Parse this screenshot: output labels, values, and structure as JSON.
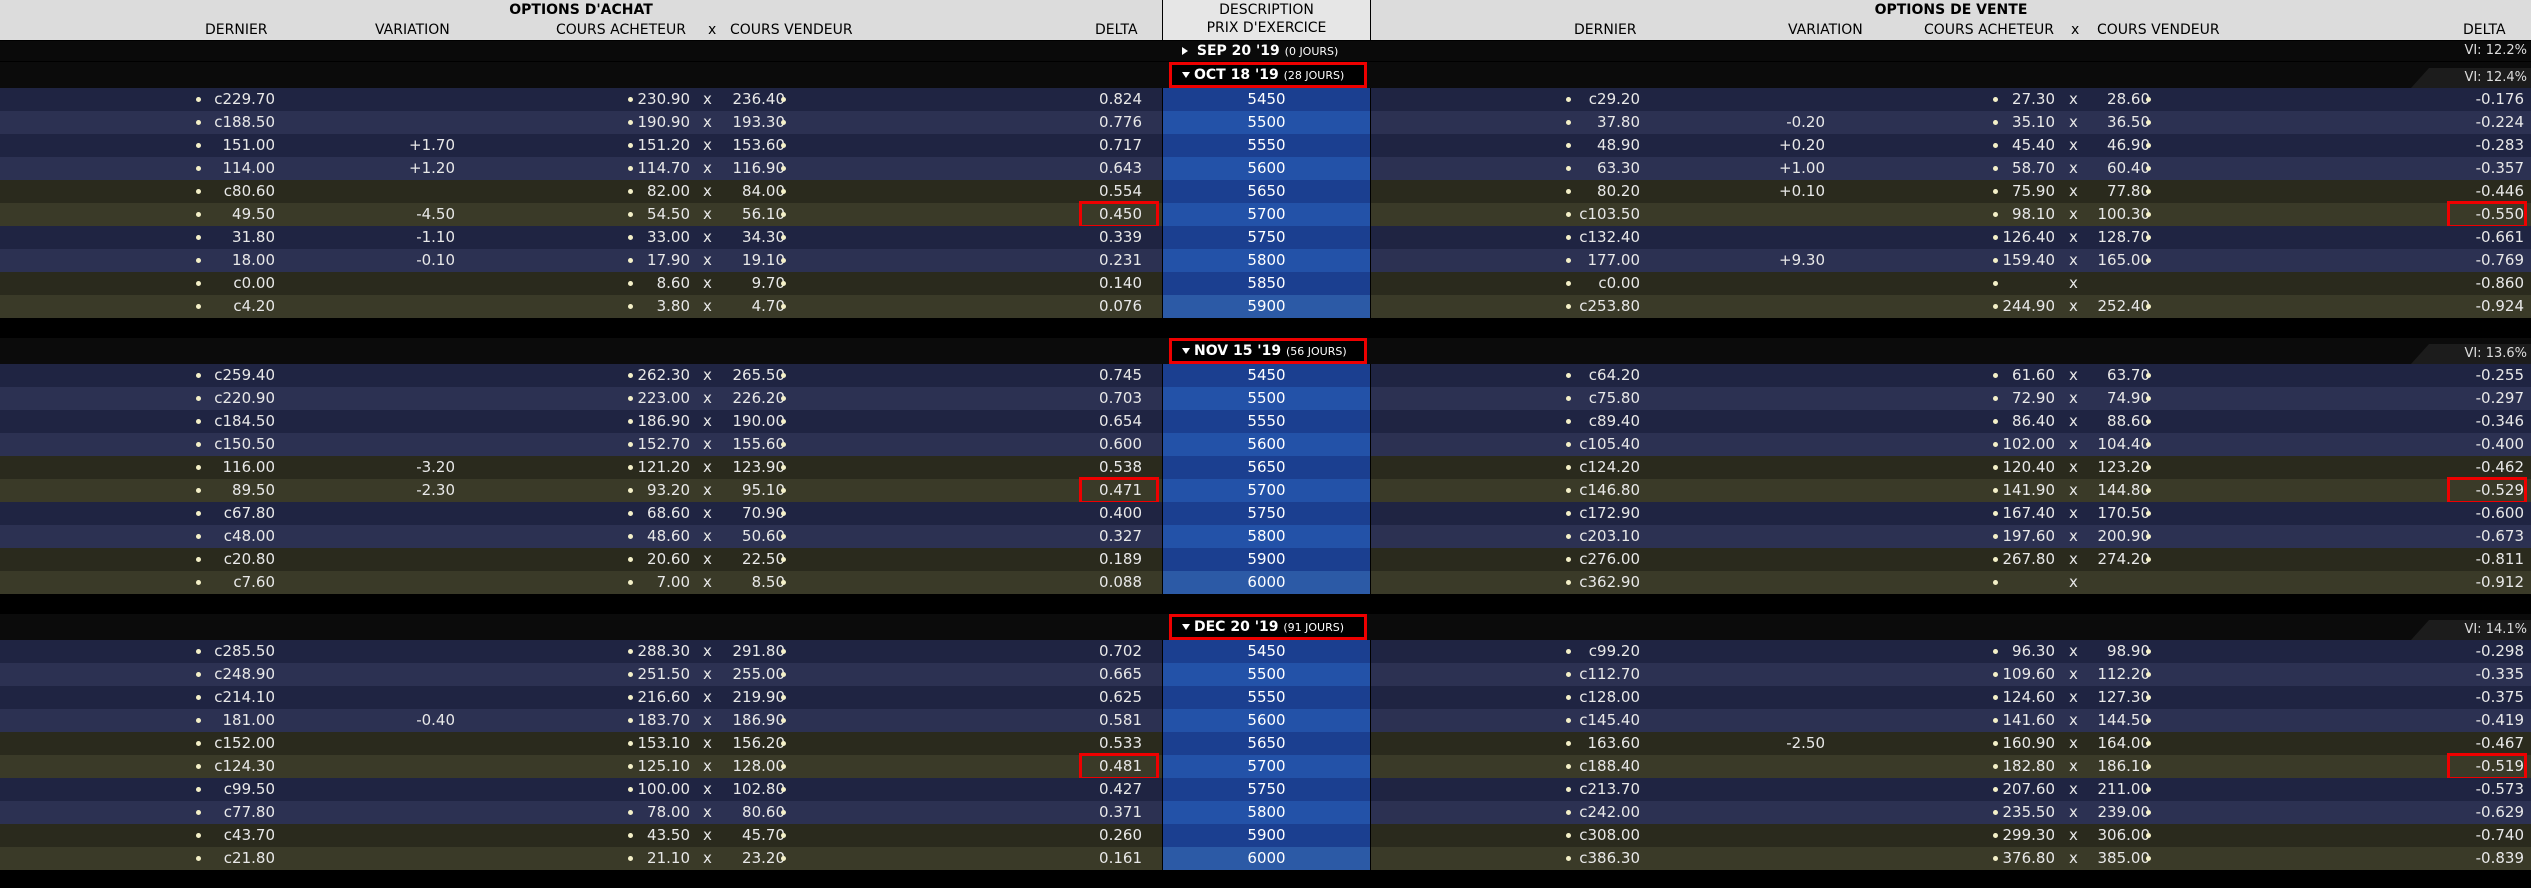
{
  "headers": {
    "calls_title": "OPTIONS D'ACHAT",
    "puts_title": "OPTIONS DE VENTE",
    "description": "DESCRIPTION",
    "strike": "PRIX D'EXERCICE",
    "last": "DERNIER",
    "change": "VARIATION",
    "bid": "COURS ACHETEUR",
    "x": "x",
    "ask": "COURS VENDEUR",
    "delta": "DELTA"
  },
  "sep_expiry": {
    "label": "SEP 20 '19",
    "days": "(0 JOURS)",
    "vi": "VI: 12.2%"
  },
  "expiries": [
    {
      "label": "OCT 18 '19",
      "days": "(28 JOURS)",
      "vi": "VI: 12.4%",
      "rows": [
        {
          "strike": "5450",
          "c_last": "c229.70",
          "c_chg": "",
          "c_bid": "230.90",
          "c_ask": "236.40",
          "c_delta": "0.824",
          "p_last": "c29.20",
          "p_chg": "",
          "p_bid": "27.30",
          "p_ask": "28.60",
          "p_delta": "-0.176"
        },
        {
          "strike": "5500",
          "c_last": "c188.50",
          "c_chg": "",
          "c_bid": "190.90",
          "c_ask": "193.30",
          "c_delta": "0.776",
          "p_last": "37.80",
          "p_chg": "-0.20",
          "p_bid": "35.10",
          "p_ask": "36.50",
          "p_delta": "-0.224"
        },
        {
          "strike": "5550",
          "c_last": "151.00",
          "c_chg": "+1.70",
          "c_bid": "151.20",
          "c_ask": "153.60",
          "c_delta": "0.717",
          "p_last": "48.90",
          "p_chg": "+0.20",
          "p_bid": "45.40",
          "p_ask": "46.90",
          "p_delta": "-0.283"
        },
        {
          "strike": "5600",
          "c_last": "114.00",
          "c_chg": "+1.20",
          "c_bid": "114.70",
          "c_ask": "116.90",
          "c_delta": "0.643",
          "p_last": "63.30",
          "p_chg": "+1.00",
          "p_bid": "58.70",
          "p_ask": "60.40",
          "p_delta": "-0.357"
        },
        {
          "strike": "5650",
          "c_last": "c80.60",
          "c_chg": "",
          "c_bid": "82.00",
          "c_ask": "84.00",
          "c_delta": "0.554",
          "p_last": "80.20",
          "p_chg": "+0.10",
          "p_bid": "75.90",
          "p_ask": "77.80",
          "p_delta": "-0.446"
        },
        {
          "strike": "5700",
          "c_last": "49.50",
          "c_chg": "-4.50",
          "c_bid": "54.50",
          "c_ask": "56.10",
          "c_delta": "0.450",
          "p_last": "c103.50",
          "p_chg": "",
          "p_bid": "98.10",
          "p_ask": "100.30",
          "p_delta": "-0.550"
        },
        {
          "strike": "5750",
          "c_last": "31.80",
          "c_chg": "-1.10",
          "c_bid": "33.00",
          "c_ask": "34.30",
          "c_delta": "0.339",
          "p_last": "c132.40",
          "p_chg": "",
          "p_bid": "126.40",
          "p_ask": "128.70",
          "p_delta": "-0.661"
        },
        {
          "strike": "5800",
          "c_last": "18.00",
          "c_chg": "-0.10",
          "c_bid": "17.90",
          "c_ask": "19.10",
          "c_delta": "0.231",
          "p_last": "177.00",
          "p_chg": "+9.30",
          "p_bid": "159.40",
          "p_ask": "165.00",
          "p_delta": "-0.769"
        },
        {
          "strike": "5850",
          "c_last": "c0.00",
          "c_chg": "",
          "c_bid": "8.60",
          "c_ask": "9.70",
          "c_delta": "0.140",
          "p_last": "c0.00",
          "p_chg": "",
          "p_bid": "",
          "p_ask": "",
          "p_delta": "-0.860"
        },
        {
          "strike": "5900",
          "c_last": "c4.20",
          "c_chg": "",
          "c_bid": "3.80",
          "c_ask": "4.70",
          "c_delta": "0.076",
          "p_last": "c253.80",
          "p_chg": "",
          "p_bid": "244.90",
          "p_ask": "252.40",
          "p_delta": "-0.924"
        }
      ]
    },
    {
      "label": "NOV 15 '19",
      "days": "(56 JOURS)",
      "vi": "VI: 13.6%",
      "rows": [
        {
          "strike": "5450",
          "c_last": "c259.40",
          "c_chg": "",
          "c_bid": "262.30",
          "c_ask": "265.50",
          "c_delta": "0.745",
          "p_last": "c64.20",
          "p_chg": "",
          "p_bid": "61.60",
          "p_ask": "63.70",
          "p_delta": "-0.255"
        },
        {
          "strike": "5500",
          "c_last": "c220.90",
          "c_chg": "",
          "c_bid": "223.00",
          "c_ask": "226.20",
          "c_delta": "0.703",
          "p_last": "c75.80",
          "p_chg": "",
          "p_bid": "72.90",
          "p_ask": "74.90",
          "p_delta": "-0.297"
        },
        {
          "strike": "5550",
          "c_last": "c184.50",
          "c_chg": "",
          "c_bid": "186.90",
          "c_ask": "190.00",
          "c_delta": "0.654",
          "p_last": "c89.40",
          "p_chg": "",
          "p_bid": "86.40",
          "p_ask": "88.60",
          "p_delta": "-0.346"
        },
        {
          "strike": "5600",
          "c_last": "c150.50",
          "c_chg": "",
          "c_bid": "152.70",
          "c_ask": "155.60",
          "c_delta": "0.600",
          "p_last": "c105.40",
          "p_chg": "",
          "p_bid": "102.00",
          "p_ask": "104.40",
          "p_delta": "-0.400"
        },
        {
          "strike": "5650",
          "c_last": "116.00",
          "c_chg": "-3.20",
          "c_bid": "121.20",
          "c_ask": "123.90",
          "c_delta": "0.538",
          "p_last": "c124.20",
          "p_chg": "",
          "p_bid": "120.40",
          "p_ask": "123.20",
          "p_delta": "-0.462"
        },
        {
          "strike": "5700",
          "c_last": "89.50",
          "c_chg": "-2.30",
          "c_bid": "93.20",
          "c_ask": "95.10",
          "c_delta": "0.471",
          "p_last": "c146.80",
          "p_chg": "",
          "p_bid": "141.90",
          "p_ask": "144.80",
          "p_delta": "-0.529"
        },
        {
          "strike": "5750",
          "c_last": "c67.80",
          "c_chg": "",
          "c_bid": "68.60",
          "c_ask": "70.90",
          "c_delta": "0.400",
          "p_last": "c172.90",
          "p_chg": "",
          "p_bid": "167.40",
          "p_ask": "170.50",
          "p_delta": "-0.600"
        },
        {
          "strike": "5800",
          "c_last": "c48.00",
          "c_chg": "",
          "c_bid": "48.60",
          "c_ask": "50.60",
          "c_delta": "0.327",
          "p_last": "c203.10",
          "p_chg": "",
          "p_bid": "197.60",
          "p_ask": "200.90",
          "p_delta": "-0.673"
        },
        {
          "strike": "5900",
          "c_last": "c20.80",
          "c_chg": "",
          "c_bid": "20.60",
          "c_ask": "22.50",
          "c_delta": "0.189",
          "p_last": "c276.00",
          "p_chg": "",
          "p_bid": "267.80",
          "p_ask": "274.20",
          "p_delta": "-0.811"
        },
        {
          "strike": "6000",
          "c_last": "c7.60",
          "c_chg": "",
          "c_bid": "7.00",
          "c_ask": "8.50",
          "c_delta": "0.088",
          "p_last": "c362.90",
          "p_chg": "",
          "p_bid": "",
          "p_ask": "",
          "p_delta": "-0.912"
        }
      ]
    },
    {
      "label": "DEC 20 '19",
      "days": "(91 JOURS)",
      "vi": "VI: 14.1%",
      "rows": [
        {
          "strike": "5450",
          "c_last": "c285.50",
          "c_chg": "",
          "c_bid": "288.30",
          "c_ask": "291.80",
          "c_delta": "0.702",
          "p_last": "c99.20",
          "p_chg": "",
          "p_bid": "96.30",
          "p_ask": "98.90",
          "p_delta": "-0.298"
        },
        {
          "strike": "5500",
          "c_last": "c248.90",
          "c_chg": "",
          "c_bid": "251.50",
          "c_ask": "255.00",
          "c_delta": "0.665",
          "p_last": "c112.70",
          "p_chg": "",
          "p_bid": "109.60",
          "p_ask": "112.20",
          "p_delta": "-0.335"
        },
        {
          "strike": "5550",
          "c_last": "c214.10",
          "c_chg": "",
          "c_bid": "216.60",
          "c_ask": "219.90",
          "c_delta": "0.625",
          "p_last": "c128.00",
          "p_chg": "",
          "p_bid": "124.60",
          "p_ask": "127.30",
          "p_delta": "-0.375"
        },
        {
          "strike": "5600",
          "c_last": "181.00",
          "c_chg": "-0.40",
          "c_bid": "183.70",
          "c_ask": "186.90",
          "c_delta": "0.581",
          "p_last": "c145.40",
          "p_chg": "",
          "p_bid": "141.60",
          "p_ask": "144.50",
          "p_delta": "-0.419"
        },
        {
          "strike": "5650",
          "c_last": "c152.00",
          "c_chg": "",
          "c_bid": "153.10",
          "c_ask": "156.20",
          "c_delta": "0.533",
          "p_last": "163.60",
          "p_chg": "-2.50",
          "p_bid": "160.90",
          "p_ask": "164.00",
          "p_delta": "-0.467"
        },
        {
          "strike": "5700",
          "c_last": "c124.30",
          "c_chg": "",
          "c_bid": "125.10",
          "c_ask": "128.00",
          "c_delta": "0.481",
          "p_last": "c188.40",
          "p_chg": "",
          "p_bid": "182.80",
          "p_ask": "186.10",
          "p_delta": "-0.519"
        },
        {
          "strike": "5750",
          "c_last": "c99.50",
          "c_chg": "",
          "c_bid": "100.00",
          "c_ask": "102.80",
          "c_delta": "0.427",
          "p_last": "c213.70",
          "p_chg": "",
          "p_bid": "207.60",
          "p_ask": "211.00",
          "p_delta": "-0.573"
        },
        {
          "strike": "5800",
          "c_last": "c77.80",
          "c_chg": "",
          "c_bid": "78.00",
          "c_ask": "80.60",
          "c_delta": "0.371",
          "p_last": "c242.00",
          "p_chg": "",
          "p_bid": "235.50",
          "p_ask": "239.00",
          "p_delta": "-0.629"
        },
        {
          "strike": "5900",
          "c_last": "c43.70",
          "c_chg": "",
          "c_bid": "43.50",
          "c_ask": "45.70",
          "c_delta": "0.260",
          "p_last": "c308.00",
          "p_chg": "",
          "p_bid": "299.30",
          "p_ask": "306.00",
          "p_delta": "-0.740"
        },
        {
          "strike": "6000",
          "c_last": "c21.80",
          "c_chg": "",
          "c_bid": "21.10",
          "c_ask": "23.20",
          "c_delta": "0.161",
          "p_last": "c386.30",
          "p_chg": "",
          "p_bid": "376.80",
          "p_ask": "385.00",
          "p_delta": "-0.839"
        }
      ]
    }
  ],
  "colors": {
    "accent_red": "#e00000",
    "strike_blue": "#1a3f8f",
    "row_navy_a": "#1e2340",
    "row_navy_b": "#2a2f4f",
    "row_olive_a": "#2a2a1e",
    "row_olive_b": "#3b3b28"
  }
}
